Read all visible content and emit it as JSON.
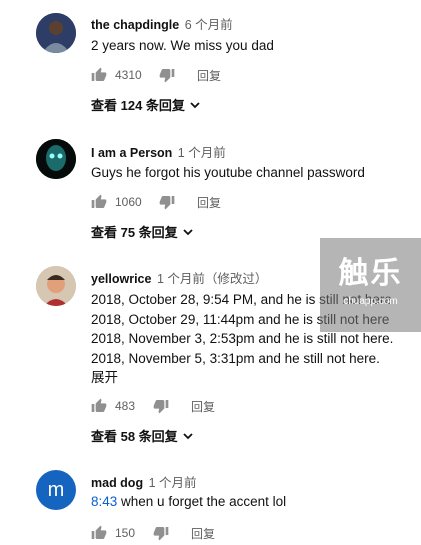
{
  "comments": [
    {
      "author": "the chapdingle",
      "time": "6 个月前",
      "text": "2 years now. We miss you dad",
      "likes": "4310",
      "reply_label": "回复",
      "view_replies": "查看 124 条回复"
    },
    {
      "author": "I am a Person",
      "time": "1 个月前",
      "text": "Guys he forgot his youtube channel password",
      "likes": "1060",
      "reply_label": "回复",
      "view_replies": "查看 75 条回复"
    },
    {
      "author": "yellowrice",
      "time": "1 个月前（修改过）",
      "lines": [
        "2018, October 28, 9:54 PM, and he is still not here",
        "2018, October 29, 11:44pm and he is still not here",
        "2018, November 3, 2:53pm and he is still not here.",
        "2018, November 5, 3:31pm and he still not here."
      ],
      "expand_label": "展开",
      "likes": "483",
      "reply_label": "回复",
      "view_replies": "查看 58 条回复"
    },
    {
      "author": "mad dog",
      "time": "1 个月前",
      "avatar_letter": "m",
      "timestamp_link": "8:43",
      "text_rest": " when u forget the accent lol",
      "likes": "150",
      "reply_label": "回复"
    }
  ],
  "watermark": {
    "logo": "触乐",
    "url": "chuapp.com"
  },
  "colors": {
    "link": "#065fd4",
    "avatar_m": "#1565c0",
    "muted": "#606060"
  },
  "icons": [
    "thumb-up-icon",
    "thumb-down-icon",
    "chevron-down-icon"
  ]
}
